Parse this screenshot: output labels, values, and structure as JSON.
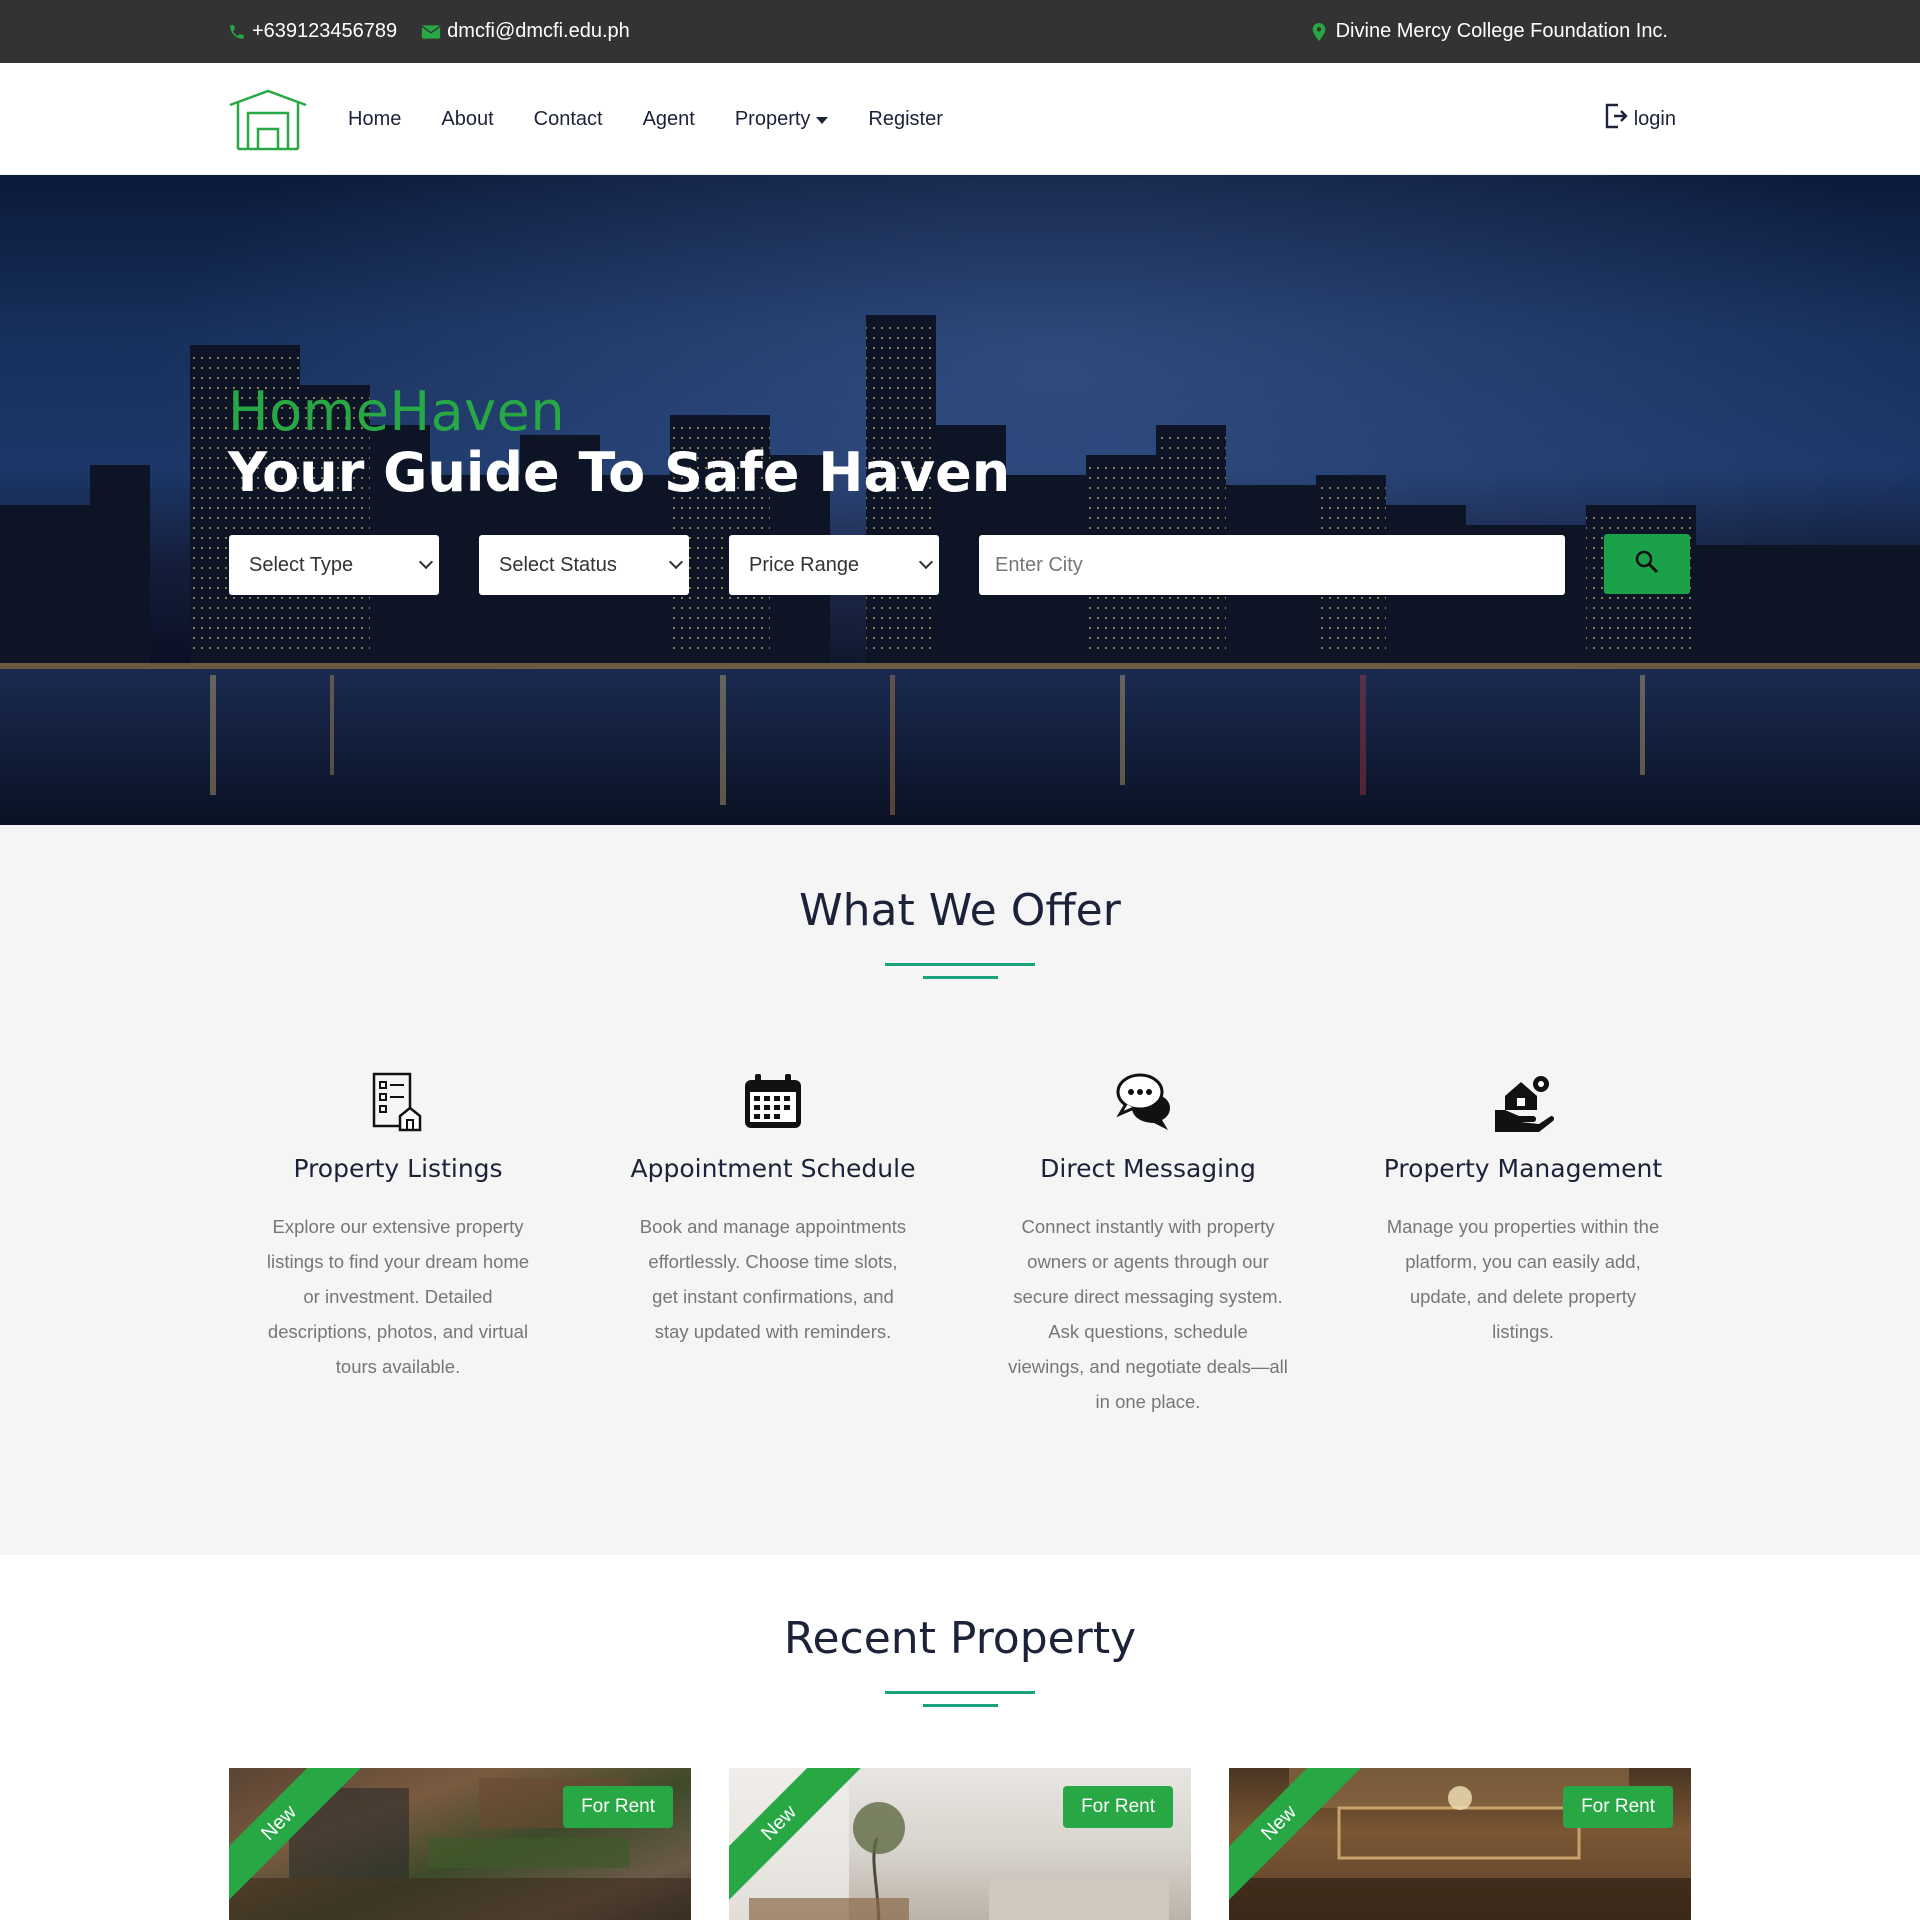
{
  "topbar": {
    "phone": "+639123456789",
    "email": "dmcfi@dmcfi.edu.ph",
    "location": "Divine Mercy College Foundation Inc."
  },
  "nav": {
    "items": [
      "Home",
      "About",
      "Contact",
      "Agent",
      "Property",
      "Register"
    ],
    "login": "login"
  },
  "hero": {
    "brand": "HomeHaven",
    "tagline": "Your Guide To Safe Haven",
    "type_select": "Select Type",
    "status_select": "Select Status",
    "price_select": "Price Range",
    "city_placeholder": "Enter City"
  },
  "offer": {
    "title": "What We Offer",
    "cards": [
      {
        "icon": "property-listings-icon",
        "title": "Property Listings",
        "text": "Explore our extensive property listings to find your dream home or investment. Detailed descriptions, photos, and virtual tours available."
      },
      {
        "icon": "calendar-icon",
        "title": "Appointment Schedule",
        "text": "Book and manage appointments effortlessly. Choose time slots, get instant confirmations, and stay updated with reminders."
      },
      {
        "icon": "chat-icon",
        "title": "Direct Messaging",
        "text": "Connect instantly with property owners or agents through our secure direct messaging system. Ask questions, schedule viewings, and negotiate deals—all in one place."
      },
      {
        "icon": "property-management-icon",
        "title": "Property Management",
        "text": "Manage you properties within the platform, you can easily add, update, and delete property listings."
      }
    ]
  },
  "recent": {
    "title": "Recent Property",
    "properties": [
      {
        "ribbon": "New",
        "status": "For Rent"
      },
      {
        "ribbon": "New",
        "status": "For Rent"
      },
      {
        "ribbon": "New",
        "status": "For Rent"
      }
    ]
  },
  "colors": {
    "accent_green": "#28a745",
    "topbar_bg": "#333333",
    "heading_navy": "#1c2238"
  }
}
